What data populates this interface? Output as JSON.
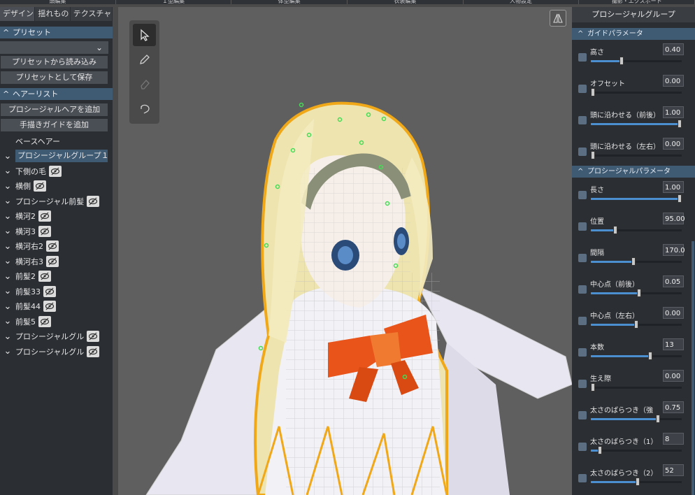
{
  "topbar": {
    "tabs": [
      "頭編集",
      "Ｉ型編集",
      "体型編集",
      "衣装編集",
      "人物設定",
      "撮影・エクスポート"
    ]
  },
  "left": {
    "tabs": [
      "デザイン",
      "揺れもの",
      "テクスチャ"
    ],
    "preset_section": "プリセット",
    "preset_select": "",
    "load_preset": "プリセットから読み込み",
    "save_preset": "プリセットとして保存",
    "hairlist_section": "ヘアーリスト",
    "add_procedural": "プロシージャルヘアを追加",
    "add_guide": "手描きガイドを追加",
    "items": [
      {
        "label": "ベースヘアー",
        "chev": false,
        "eye": false,
        "selected": false
      },
      {
        "label": "プロシージャルグループ１",
        "chev": true,
        "eye": false,
        "selected": true
      },
      {
        "label": "下側の毛",
        "chev": true,
        "eye": true,
        "selected": false
      },
      {
        "label": "横側",
        "chev": true,
        "eye": true,
        "selected": false
      },
      {
        "label": "プロシージャル前髪",
        "chev": true,
        "eye": true,
        "selected": false
      },
      {
        "label": "横河2",
        "chev": true,
        "eye": true,
        "selected": false
      },
      {
        "label": "横河3",
        "chev": true,
        "eye": true,
        "selected": false
      },
      {
        "label": "横河右2",
        "chev": true,
        "eye": true,
        "selected": false
      },
      {
        "label": "横河右3",
        "chev": true,
        "eye": true,
        "selected": false
      },
      {
        "label": "前髪2",
        "chev": true,
        "eye": true,
        "selected": false
      },
      {
        "label": "前髪33",
        "chev": true,
        "eye": true,
        "selected": false
      },
      {
        "label": "前髪44",
        "chev": true,
        "eye": true,
        "selected": false
      },
      {
        "label": "前髪5",
        "chev": true,
        "eye": true,
        "selected": false
      },
      {
        "label": "プロシージャルグル",
        "chev": true,
        "eye": true,
        "selected": false
      },
      {
        "label": "プロシージャルグル",
        "chev": true,
        "eye": true,
        "selected": false
      }
    ]
  },
  "viewport": {
    "tools": [
      "select-arrow-icon",
      "pencil-icon",
      "eraser-icon",
      "lasso-icon"
    ]
  },
  "right": {
    "title": "プロシージャルグループ",
    "guide_section": "ガイドパラメータ",
    "guide_params": [
      {
        "name": "高さ",
        "value": "0.40",
        "level": 0.33
      },
      {
        "name": "オフセット",
        "value": "0.00",
        "level": 0.0
      },
      {
        "name": "頭に沿わせる（前後）",
        "value": "1.00",
        "level": 1.0
      },
      {
        "name": "頭に沿わせる（左右）",
        "value": "0.00",
        "level": 0.0
      }
    ],
    "proc_section": "プロシージャルパラメータ",
    "proc_params": [
      {
        "name": "長さ",
        "value": "1.00",
        "level": 1.0
      },
      {
        "name": "位置",
        "value": "95.00",
        "level": 0.26
      },
      {
        "name": "間隔",
        "value": "170.0",
        "level": 0.47
      },
      {
        "name": "中心点（前後）",
        "value": "0.05",
        "level": 0.53
      },
      {
        "name": "中心点（左右）",
        "value": "0.00",
        "level": 0.5
      },
      {
        "name": "本数",
        "value": "13",
        "level": 0.66
      },
      {
        "name": "生え際",
        "value": "0.00",
        "level": 0.0
      },
      {
        "name": "太さのばらつき（強",
        "value": "0.75",
        "level": 0.75
      },
      {
        "name": "太さのばらつき（1）",
        "value": "8",
        "level": 0.08
      },
      {
        "name": "太さのばらつき（2）",
        "value": "52",
        "level": 0.52
      }
    ]
  },
  "colors": {
    "accent": "#3f5a73",
    "slider": "#4b8fd0",
    "outline": "#f0a818"
  }
}
